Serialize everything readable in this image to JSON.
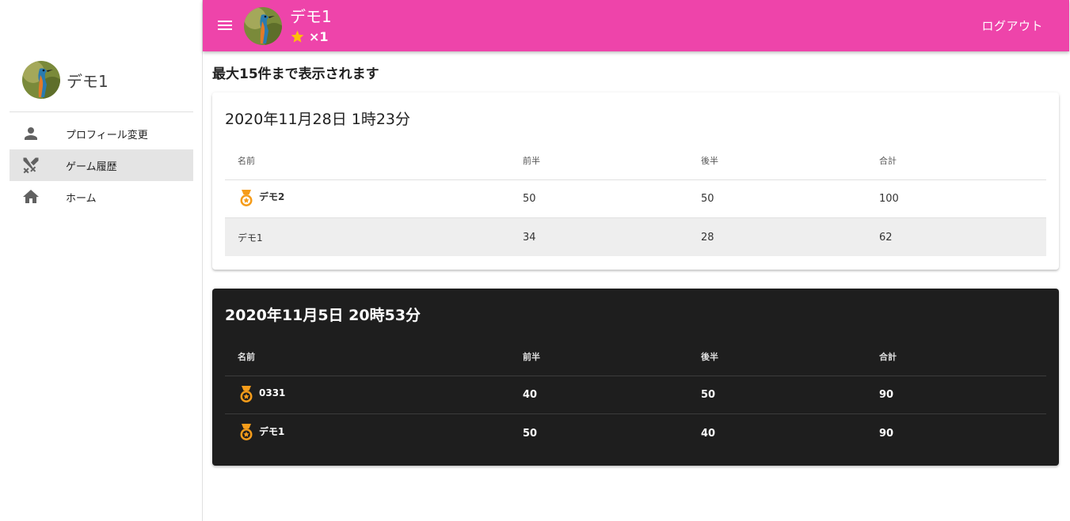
{
  "user": {
    "name": "デモ1",
    "stars": "×1"
  },
  "header": {
    "logout_label": "ログアウト"
  },
  "sidebar": {
    "items": [
      {
        "label": "プロフィール変更",
        "icon": "person-icon",
        "active": false
      },
      {
        "label": "ゲーム履歴",
        "icon": "crossed-swords-icon",
        "active": true
      },
      {
        "label": "ホーム",
        "icon": "home-icon",
        "active": false
      }
    ]
  },
  "main": {
    "notice": "最大15件まで表示されます",
    "games": [
      {
        "title": "2020年11月28日  1時23分",
        "theme": "light",
        "columns": [
          "名前",
          "前半",
          "後半",
          "合計"
        ],
        "rows": [
          {
            "name": "デモ2",
            "first": "50",
            "second": "50",
            "total": "100",
            "medal": true
          },
          {
            "name": "デモ1",
            "first": "34",
            "second": "28",
            "total": "62",
            "medal": false
          }
        ]
      },
      {
        "title": "2020年11月5日  20時53分",
        "theme": "dark",
        "columns": [
          "名前",
          "前半",
          "後半",
          "合計"
        ],
        "rows": [
          {
            "name": "0331",
            "first": "40",
            "second": "50",
            "total": "90",
            "medal": true
          },
          {
            "name": "デモ1",
            "first": "50",
            "second": "40",
            "total": "90",
            "medal": true
          }
        ]
      }
    ]
  },
  "colors": {
    "appbar": "#ee44aa",
    "star": "#ffc107",
    "medal": "#f59c1a",
    "dark_card": "#1e1e1e"
  }
}
